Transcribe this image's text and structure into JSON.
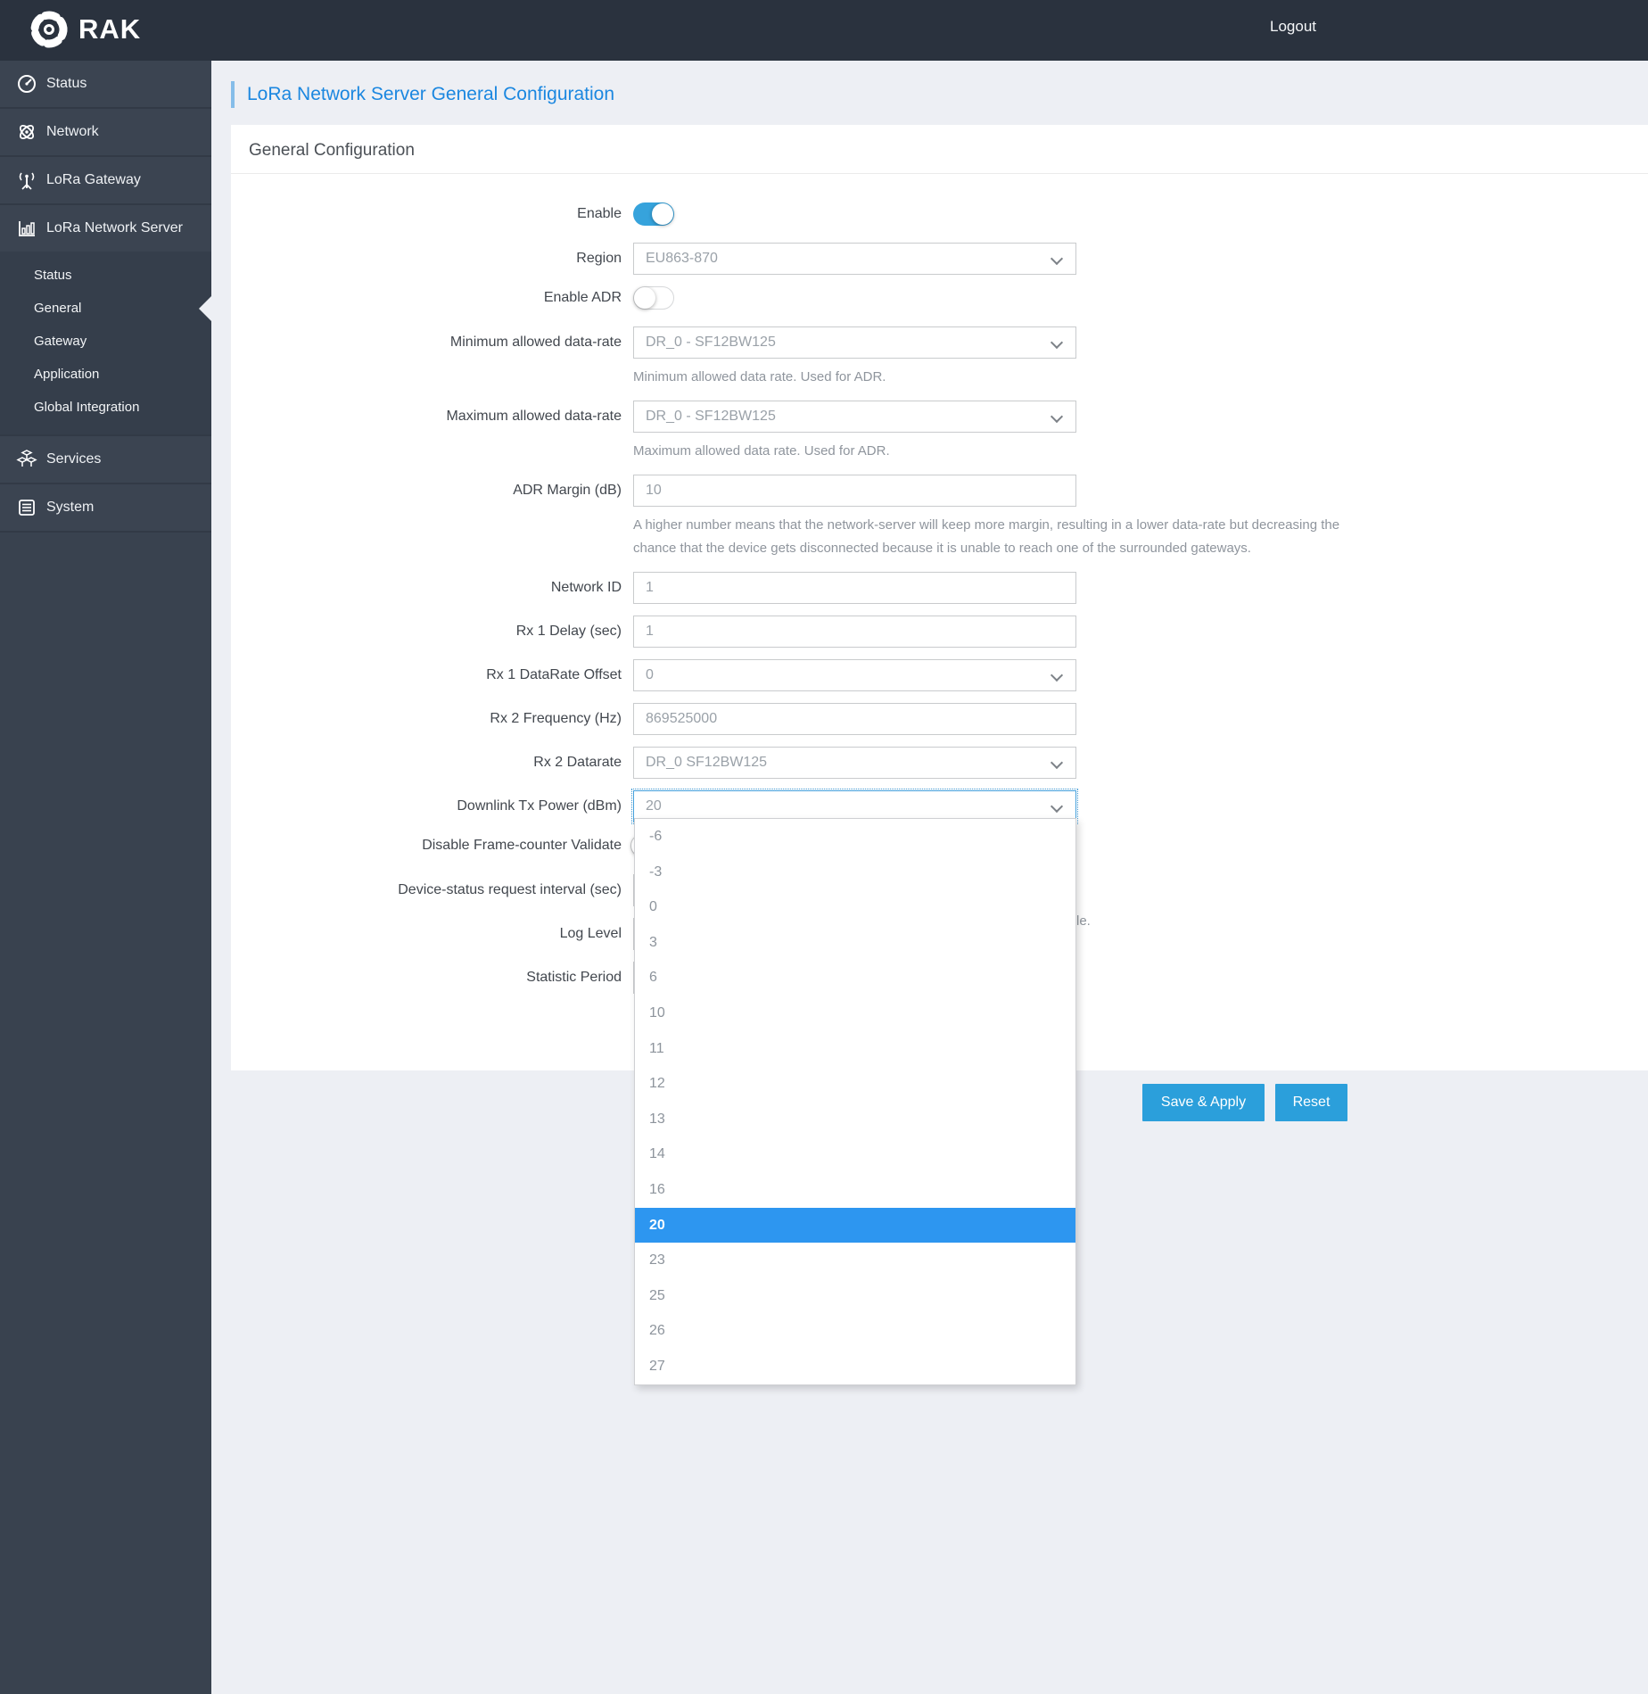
{
  "header": {
    "logo_text": "RAK",
    "logout_label": "Logout"
  },
  "sidebar": {
    "items": [
      {
        "label": "Status"
      },
      {
        "label": "Network"
      },
      {
        "label": "LoRa Gateway"
      },
      {
        "label": "LoRa Network Server"
      },
      {
        "label": "Services"
      },
      {
        "label": "System"
      }
    ],
    "submenu": [
      {
        "label": "Status"
      },
      {
        "label": "General"
      },
      {
        "label": "Gateway"
      },
      {
        "label": "Application"
      },
      {
        "label": "Global Integration"
      }
    ]
  },
  "page": {
    "title": "LoRa Network Server General Configuration",
    "card_title": "General Configuration"
  },
  "form": {
    "enable": {
      "label": "Enable",
      "state": "on"
    },
    "region": {
      "label": "Region",
      "value": "EU863-870"
    },
    "enable_adr": {
      "label": "Enable ADR",
      "state": "off"
    },
    "min_dr": {
      "label": "Minimum allowed data-rate",
      "value": "DR_0 - SF12BW125",
      "helper": "Minimum allowed data rate. Used for ADR."
    },
    "max_dr": {
      "label": "Maximum allowed data-rate",
      "value": "DR_0 - SF12BW125",
      "helper": "Maximum allowed data rate. Used for ADR."
    },
    "adr_margin": {
      "label": "ADR Margin (dB)",
      "value": "10",
      "helper": "A higher number means that the network-server will keep more margin, resulting in a lower data-rate but decreasing the chance that the device gets disconnected because it is unable to reach one of the surrounded gateways."
    },
    "network_id": {
      "label": "Network ID",
      "value": "1"
    },
    "rx1_delay": {
      "label": "Rx 1 Delay (sec)",
      "value": "1"
    },
    "rx1_dr_offset": {
      "label": "Rx 1 DataRate Offset",
      "value": "0"
    },
    "rx2_frequency": {
      "label": "Rx 2 Frequency (Hz)",
      "value": "869525000"
    },
    "rx2_datarate": {
      "label": "Rx 2 Datarate",
      "value": "DR_0 SF12BW125"
    },
    "downlink_tx_power": {
      "label": "Downlink Tx Power (dBm)",
      "value": "20"
    },
    "frame_counter": {
      "label": "Disable Frame-counter Validate",
      "state": "off"
    },
    "device_status_interval": {
      "label": "Device-status request interval (sec)",
      "helper_visible": "le."
    },
    "log_level": {
      "label": "Log Level"
    },
    "statistic_period": {
      "label": "Statistic Period"
    }
  },
  "dropdown": {
    "selected": "20",
    "options": [
      "-6",
      "-3",
      "0",
      "3",
      "6",
      "10",
      "11",
      "12",
      "13",
      "14",
      "16",
      "20",
      "23",
      "25",
      "26",
      "27"
    ]
  },
  "actions": {
    "save": "Save & Apply",
    "reset": "Reset"
  },
  "colors": {
    "accent": "#2b9fdb",
    "highlight": "#2d96f0",
    "topbar": "#2a323e",
    "sidebar": "#3b4451"
  }
}
